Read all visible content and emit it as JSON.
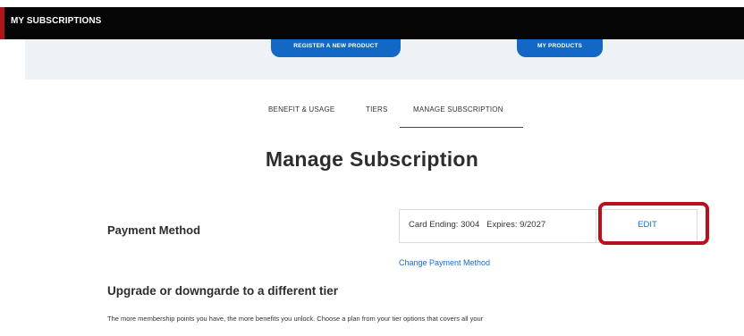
{
  "header": {
    "title": "MY SUBSCRIPTIONS",
    "accent_color": "#b0141b"
  },
  "banner": {
    "register_button": "REGISTER A NEW PRODUCT",
    "products_button": "MY PRODUCTS",
    "button_color": "#1268c4"
  },
  "tabs": [
    {
      "label": "BENEFIT & USAGE"
    },
    {
      "label": "TIERS"
    },
    {
      "label": "MANAGE SUBSCRIPTION",
      "active": true
    }
  ],
  "page_title": "Manage Subscription",
  "payment": {
    "label": "Payment Method",
    "card_info": "Card Ending: 3004   Expires: 9/2027",
    "edit_label": "EDIT",
    "change_link": "Change Payment Method"
  },
  "upgrade": {
    "title": "Upgrade or downgarde to a different tier",
    "description": "The more membership points you have, the more benefits you unlock. Choose a plan from your tier options that covers all your"
  }
}
